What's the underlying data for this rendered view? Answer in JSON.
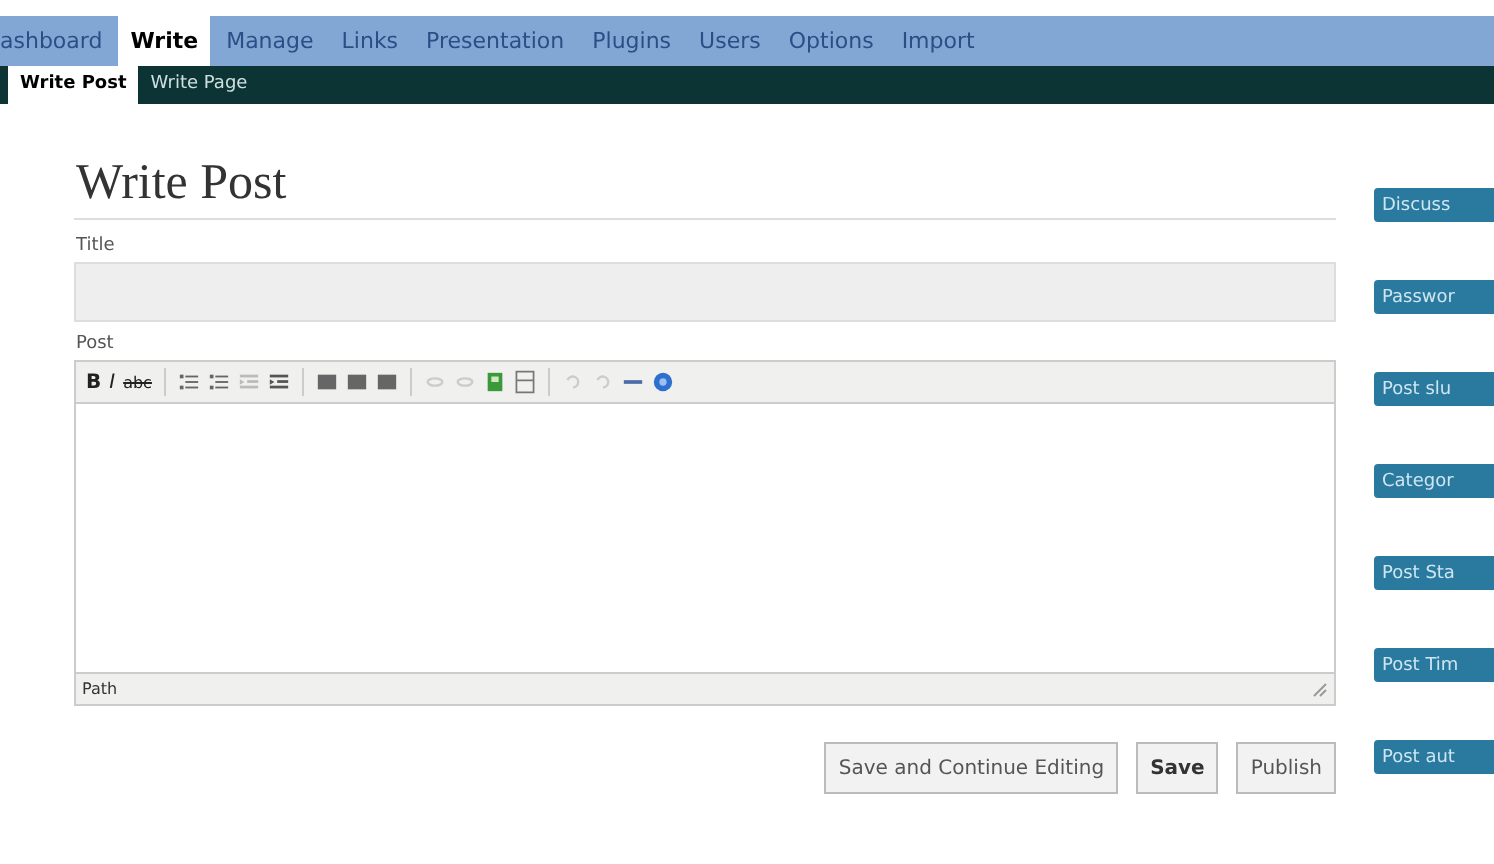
{
  "main_menu": [
    {
      "label": "ashboard",
      "selected": false
    },
    {
      "label": "Write",
      "selected": true
    },
    {
      "label": "Manage",
      "selected": false
    },
    {
      "label": "Links",
      "selected": false
    },
    {
      "label": "Presentation",
      "selected": false
    },
    {
      "label": "Plugins",
      "selected": false
    },
    {
      "label": "Users",
      "selected": false
    },
    {
      "label": "Options",
      "selected": false
    },
    {
      "label": "Import",
      "selected": false
    }
  ],
  "sub_menu": [
    {
      "label": "Write Post",
      "selected": true
    },
    {
      "label": "Write Page",
      "selected": false
    }
  ],
  "heading": "Write Post",
  "title_field": {
    "label": "Title"
  },
  "post_field": {
    "label": "Post",
    "path_label": "Path"
  },
  "toolbar": [
    {
      "kind": "bold",
      "label": "B"
    },
    {
      "kind": "italic",
      "label": "I"
    },
    {
      "kind": "strike",
      "label": "abc"
    },
    {
      "kind": "sep"
    },
    {
      "kind": "bullets"
    },
    {
      "kind": "numbers"
    },
    {
      "kind": "outdent"
    },
    {
      "kind": "indent"
    },
    {
      "kind": "sep"
    },
    {
      "kind": "align"
    },
    {
      "kind": "align"
    },
    {
      "kind": "align"
    },
    {
      "kind": "sep"
    },
    {
      "kind": "link"
    },
    {
      "kind": "unlink"
    },
    {
      "kind": "image"
    },
    {
      "kind": "more"
    },
    {
      "kind": "sep"
    },
    {
      "kind": "undo"
    },
    {
      "kind": "redo"
    },
    {
      "kind": "rule"
    },
    {
      "kind": "help"
    }
  ],
  "buttons": [
    {
      "label": "Save and Continue Editing",
      "kind": "normal"
    },
    {
      "label": "Save",
      "kind": "bold"
    },
    {
      "label": "Publish",
      "kind": "normal"
    }
  ],
  "side_panels": [
    "Discuss",
    "Passwor",
    "Post slu",
    "Categor",
    "Post Sta",
    "Post Tim",
    "Post aut"
  ]
}
